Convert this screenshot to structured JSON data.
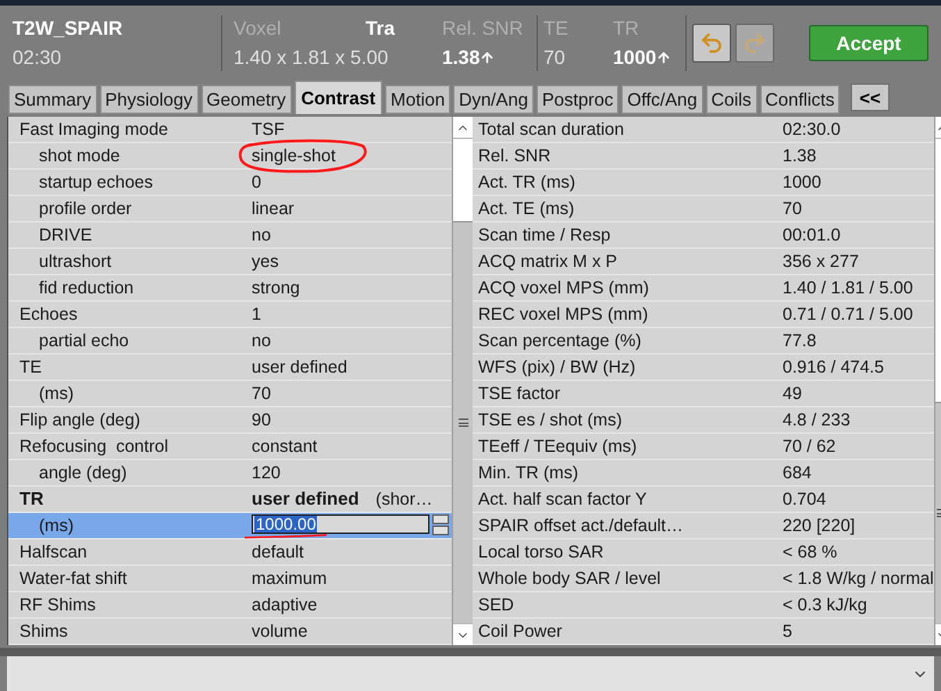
{
  "header": {
    "protocol": "T2W_SPAIR",
    "duration": "02:30",
    "voxel_label": "Voxel",
    "orientation": "Tra",
    "voxel_value": "1.40 x 1.81 x 5.00",
    "snr_label": "Rel. SNR",
    "snr_value": "1.38",
    "te_label": "TE",
    "te_value": "70",
    "tr_label": "TR",
    "tr_value": "1000",
    "accept": "Accept"
  },
  "tabs": [
    {
      "label": "Summary",
      "selected": false
    },
    {
      "label": "Physiology",
      "selected": false
    },
    {
      "label": "Geometry",
      "selected": false
    },
    {
      "label": "Contrast",
      "selected": true
    },
    {
      "label": "Motion",
      "selected": false
    },
    {
      "label": "Dyn/Ang",
      "selected": false
    },
    {
      "label": "Postproc",
      "selected": false
    },
    {
      "label": "Offc/Ang",
      "selected": false
    },
    {
      "label": "Coils",
      "selected": false
    },
    {
      "label": "Conflicts",
      "selected": false
    }
  ],
  "collapse_button": "<<",
  "parameters": [
    {
      "label": "Fast Imaging mode",
      "value": "TSF",
      "kind": "text",
      "emphasized": false,
      "selected": false,
      "children": [
        {
          "label": "shot mode",
          "value": "single-shot",
          "kind": "text",
          "selected": false,
          "circled": true
        },
        {
          "label": "startup echoes",
          "value": "0",
          "kind": "text",
          "selected": false,
          "circled": false
        },
        {
          "label": "profile order",
          "value": "linear",
          "kind": "text",
          "selected": false,
          "circled": false
        },
        {
          "label": "DRIVE",
          "value": "no",
          "kind": "text",
          "selected": false,
          "circled": false
        },
        {
          "label": "ultrashort",
          "value": "yes",
          "kind": "text",
          "selected": false,
          "circled": false
        },
        {
          "label": "fid reduction",
          "value": "strong",
          "kind": "text",
          "selected": false,
          "circled": false
        }
      ]
    },
    {
      "label": "Echoes",
      "value": "1",
      "kind": "text",
      "emphasized": false,
      "selected": false,
      "children": [
        {
          "label": "partial echo",
          "value": "no",
          "kind": "text",
          "selected": false
        }
      ]
    },
    {
      "label": "TE",
      "value": "user defined",
      "kind": "text",
      "emphasized": false,
      "selected": false,
      "children": [
        {
          "label": "(ms)",
          "value": "70",
          "kind": "text",
          "selected": false
        }
      ]
    },
    {
      "label": "Flip angle (deg)",
      "value": "90",
      "kind": "text",
      "emphasized": false,
      "selected": false
    },
    {
      "label": "Refocusing  control",
      "value": "constant",
      "kind": "text",
      "emphasized": false,
      "selected": false,
      "children": [
        {
          "label": "angle (deg)",
          "value": "120",
          "kind": "text",
          "selected": false
        }
      ]
    },
    {
      "label": "TR",
      "value": "user defined",
      "note": "(shor…",
      "kind": "text",
      "emphasized": true,
      "selected": false,
      "children": [
        {
          "label": "(ms)",
          "value": "1000.00",
          "kind": "spin_field",
          "selected": true,
          "underlined": true
        }
      ]
    },
    {
      "label": "Halfscan",
      "value": "default",
      "kind": "text",
      "emphasized": false,
      "selected": false
    },
    {
      "label": "Water-fat shift",
      "value": "maximum",
      "kind": "text",
      "emphasized": false,
      "selected": false
    },
    {
      "label": "RF Shims",
      "value": "adaptive",
      "kind": "text",
      "emphasized": false,
      "selected": false
    },
    {
      "label": "Shims",
      "value": "volume",
      "kind": "text",
      "emphasized": false,
      "selected": false
    }
  ],
  "results": [
    {
      "label": "Total scan duration",
      "value": "02:30.0"
    },
    {
      "label": "Rel. SNR",
      "value": "1.38"
    },
    {
      "label": "Act. TR (ms)",
      "value": "1000"
    },
    {
      "label": "Act. TE (ms)",
      "value": "70"
    },
    {
      "label": "Scan time / Resp",
      "value": "00:01.0"
    },
    {
      "label": "ACQ matrix M x P",
      "value": "356 x 277"
    },
    {
      "label": "ACQ voxel MPS (mm)",
      "value": "1.40 / 1.81 / 5.00"
    },
    {
      "label": "REC voxel MPS (mm)",
      "value": "0.71 / 0.71 / 5.00"
    },
    {
      "label": "Scan percentage (%)",
      "value": "77.8"
    },
    {
      "label": "WFS (pix) / BW (Hz)",
      "value": "0.916 / 474.5"
    },
    {
      "label": "TSE factor",
      "value": "49"
    },
    {
      "label": "TSE es / shot (ms)",
      "value": "4.8 / 233"
    },
    {
      "label": "TEeff / TEequiv (ms)",
      "value": "70 / 62"
    },
    {
      "label": "Min. TR (ms)",
      "value": "684"
    },
    {
      "label": "Act. half scan factor Y",
      "value": "0.704"
    },
    {
      "label": "SPAIR offset act./default…",
      "value": "220 [220]"
    },
    {
      "label": "Local torso SAR",
      "value": "< 68 %"
    },
    {
      "label": "Whole body SAR / level",
      "value": "< 1.8 W/kg / normal"
    },
    {
      "label": "SED",
      "value": "< 0.3 kJ/kg"
    },
    {
      "label": "Coil Power",
      "value": "5"
    }
  ]
}
